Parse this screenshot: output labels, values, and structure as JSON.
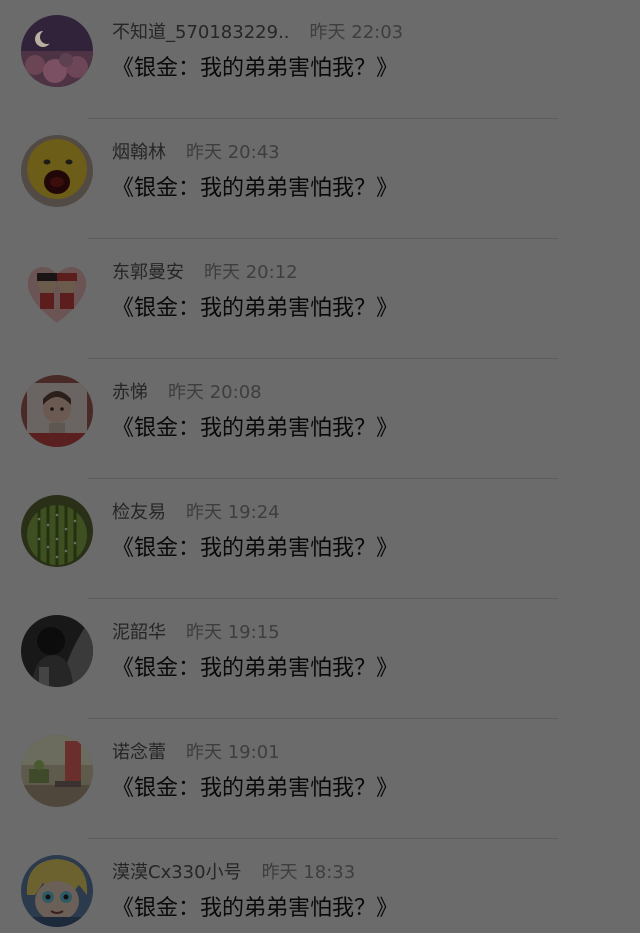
{
  "comments": [
    {
      "username": "不知道_570183229..",
      "time": "昨天 22:03",
      "message": "《银金：我的弟弟害怕我？》",
      "avatar_icon": "moon-night-avatar-icon"
    },
    {
      "username": "烟翰林",
      "time": "昨天 20:43",
      "message": "《银金：我的弟弟害怕我？》",
      "avatar_icon": "yellow-face-avatar-icon"
    },
    {
      "username": "东郭曼安",
      "time": "昨天 20:12",
      "message": "《银金：我的弟弟害怕我？》",
      "avatar_icon": "couple-heart-avatar-icon"
    },
    {
      "username": "赤悌",
      "time": "昨天 20:08",
      "message": "《银金：我的弟弟害怕我？》",
      "avatar_icon": "child-photo-avatar-icon"
    },
    {
      "username": "检友易",
      "time": "昨天 19:24",
      "message": "《银金：我的弟弟害怕我？》",
      "avatar_icon": "cactus-avatar-icon"
    },
    {
      "username": "泥韶华",
      "time": "昨天 19:15",
      "message": "《银金：我的弟弟害怕我？》",
      "avatar_icon": "dark-figure-avatar-icon"
    },
    {
      "username": "诺念蕾",
      "time": "昨天 19:01",
      "message": "《银金：我的弟弟害怕我？》",
      "avatar_icon": "room-scene-avatar-icon"
    },
    {
      "username": "漠漠Cx330小号",
      "time": "昨天 18:33",
      "message": "《银金：我的弟弟害怕我？》",
      "avatar_icon": "anime-character-avatar-icon"
    }
  ]
}
